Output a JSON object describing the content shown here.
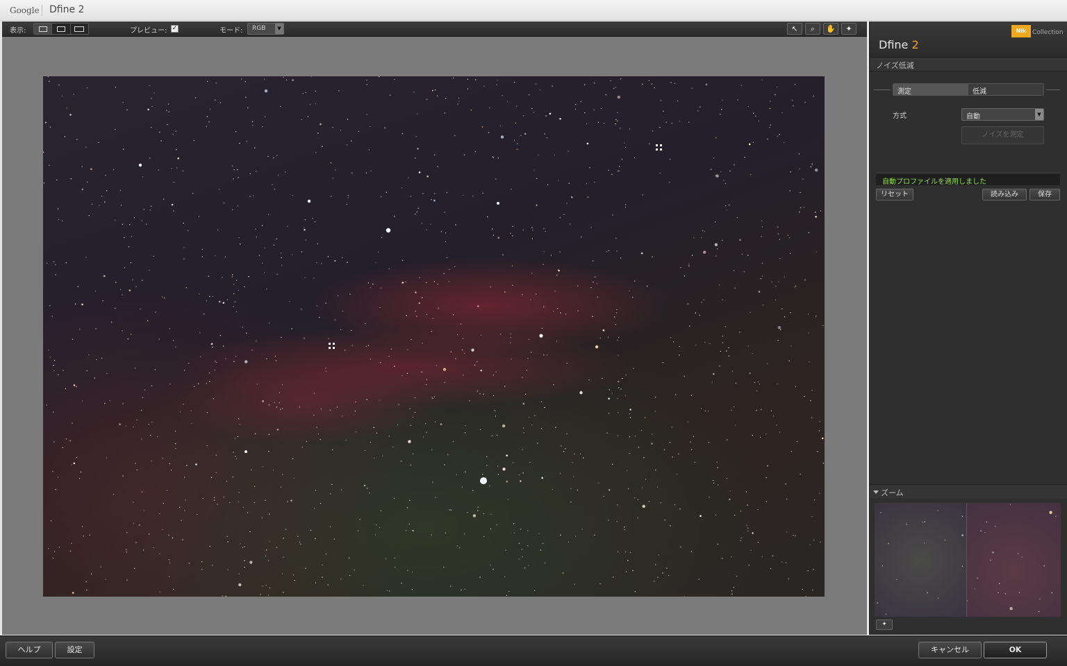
{
  "window": {
    "brand": "Google",
    "title": "Dfine 2"
  },
  "toolbar": {
    "view_label": "表示:",
    "preview_label": "プレビュー:",
    "preview_checked": true,
    "mode_label": "モード:",
    "mode_value": "RGB",
    "tools": [
      {
        "icon": "pointer-arrow-icon",
        "glyph": "↖"
      },
      {
        "icon": "zoom-magnifier-icon",
        "glyph": "⌕"
      },
      {
        "icon": "hand-pan-icon",
        "glyph": "✋"
      },
      {
        "icon": "control-point-icon",
        "glyph": "✦"
      }
    ]
  },
  "panel": {
    "brand_badge": "Nik",
    "brand_collection": "Collection",
    "product_name": "Dfine",
    "product_version": "2",
    "section_noise": "ノイズ低減",
    "tab_measure": "測定",
    "tab_reduce": "低減",
    "method_label": "方式",
    "method_value": "自動",
    "measure_button": "ノイズを測定",
    "status_message": "自動プロファイルを適用しました",
    "reset_button": "リセット",
    "load_button": "読み込み",
    "save_button": "保存",
    "zoom_title": "ズーム"
  },
  "bottom": {
    "help_button": "ヘルプ",
    "settings_button": "設定",
    "cancel_button": "キャンセル",
    "ok_button": "OK"
  },
  "colors": {
    "accent_orange": "#f0a820",
    "status_green": "#8fe04a",
    "zoom_divider_red": "#e02020"
  }
}
